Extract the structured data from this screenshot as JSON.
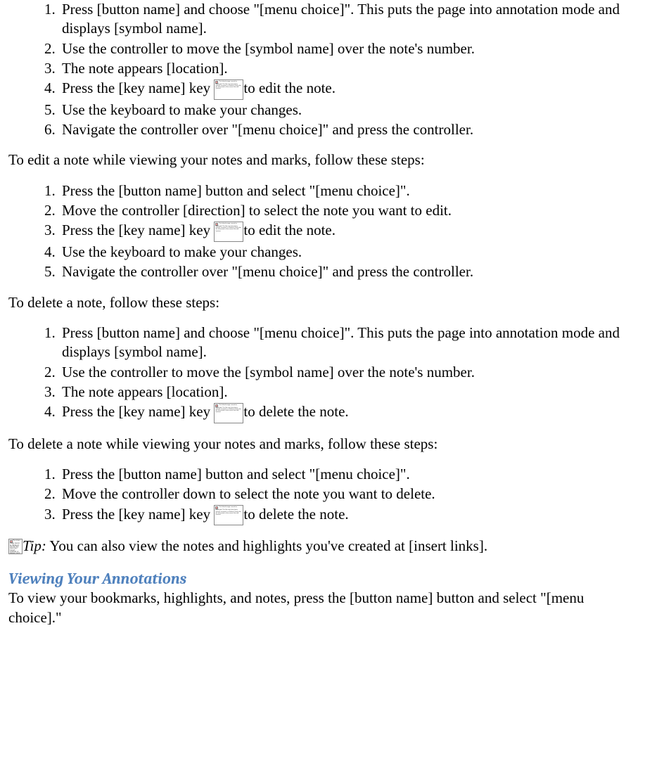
{
  "brokenImgText": "The linked image cannot be displayed. The file may have been moved, renamed, or deleted. Verify that the link points to the correct file and location.",
  "section1_list": [
    "Press [button name] and choose \"[menu choice]\". This puts the page into annotation mode and displays [symbol name].",
    "Use the controller to move the [symbol name] over the note's number.",
    "The note appears [location].",
    {
      "before": "Press the [key name] key ",
      "after": "to edit the note."
    },
    "Use the keyboard to make your changes.",
    "Navigate the controller over \"[menu choice]\" and press the controller."
  ],
  "para2": "To edit a note while viewing your notes and marks, follow these steps:",
  "section2_list": [
    "Press the [button name] button and select \"[menu choice]\".",
    "Move the controller [direction] to select the note you want to edit.",
    {
      "before": "Press the [key name] key ",
      "after": "to edit the note."
    },
    "Use the keyboard to make your changes.",
    "Navigate the controller over \"[menu choice]\" and press the controller."
  ],
  "para3": "To delete a note, follow these steps:",
  "section3_list": [
    "Press [button name] and choose \"[menu choice]\". This puts the page into annotation mode and displays [symbol name].",
    "Use the controller to move the [symbol name] over the note's number.",
    "The note appears [location].",
    {
      "before": "Press the [key name] key ",
      "after": "to delete the note."
    }
  ],
  "para4": "To delete a note while viewing your notes and marks, follow these steps:",
  "section4_list": [
    "Press the [button name] button and select \"[menu choice]\".",
    "Move the controller down to select the note you want to delete.",
    {
      "before": "Press the [key name] key ",
      "after": "to delete the note."
    }
  ],
  "tip_label": "Tip:",
  "tip_text": " You can also view the notes and highlights you've created at [insert links].",
  "heading": "Viewing Your Annotations",
  "para5": "To view your bookmarks, highlights, and notes, press the [button name] button and select \"[menu choice].\""
}
